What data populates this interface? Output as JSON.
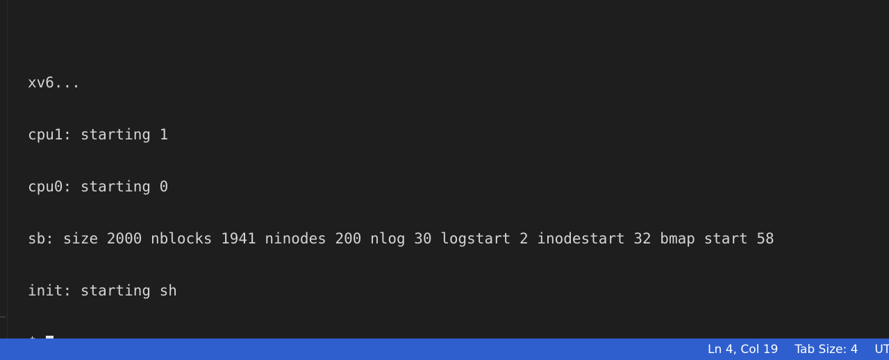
{
  "terminal": {
    "cut_line": "                                                                                              ",
    "lines": [
      "xv6...",
      "cpu1: starting 1",
      "cpu0: starting 0",
      "sb: size 2000 nblocks 1941 ninodes 200 nlog 30 logstart 2 inodestart 32 bmap start 58",
      "init: starting sh"
    ],
    "prompt": "$"
  },
  "status_bar": {
    "cursor_position": "Ln 4, Col 19",
    "tab_size": "Tab Size: 4",
    "encoding": "UTF"
  },
  "colors": {
    "background": "#1e1e1e",
    "text": "#d4d4d4",
    "status_bar": "#2f5fce"
  }
}
